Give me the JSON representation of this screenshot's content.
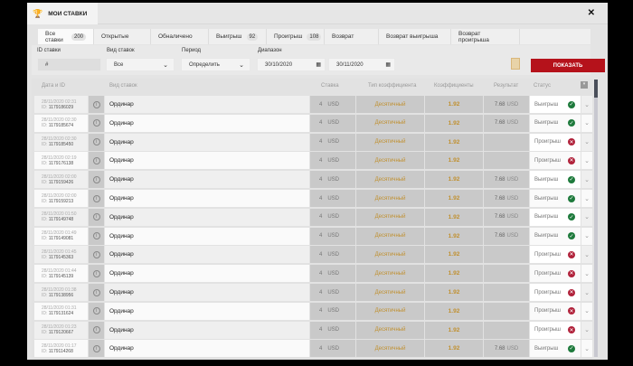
{
  "window": {
    "title": "МОИ СТАВКИ"
  },
  "tabs": [
    {
      "label": "Все ставки",
      "count": "200"
    },
    {
      "label": "Открытые"
    },
    {
      "label": "Обналичено"
    },
    {
      "label": "Выигрыш",
      "count": "92"
    },
    {
      "label": "Проигрыш",
      "count": "108"
    },
    {
      "label": "Возврат"
    },
    {
      "label": "Возврат выигрыша"
    },
    {
      "label": "Возврат проигрыша"
    }
  ],
  "filters": {
    "id_label": "ID ставки",
    "id_placeholder": "#",
    "type_label": "Вид ставок",
    "type_value": "Все",
    "period_label": "Период",
    "period_value": "Определить",
    "range_label": "Диапазон",
    "date_from": "30/10/2020",
    "date_to": "30/11/2020",
    "show_button": "ПОКАЗАТЬ"
  },
  "columns": [
    "Дата и ID",
    "Вид ставок",
    "Ставка",
    "Тип коэффициента",
    "Коэффициенты",
    "Результат",
    "Статус"
  ],
  "colors": {
    "win": "#1e7a3c",
    "loss": "#b0213a",
    "accent": "#b5121b",
    "odds": "#c09030"
  },
  "rows": [
    {
      "date": "28/11/2020 02:31",
      "id": "1179186029",
      "type": "Ординар",
      "stake": "4",
      "currency": "USD",
      "odds_type": "Десятичный",
      "odds": "1.92",
      "result": "7.68",
      "result_cur": "USD",
      "status": "Выигрыш",
      "win": true
    },
    {
      "date": "28/11/2020 02:30",
      "id": "1179185674",
      "type": "Ординар",
      "stake": "4",
      "currency": "USD",
      "odds_type": "Десятичный",
      "odds": "1.92",
      "result": "7.68",
      "result_cur": "USD",
      "status": "Выигрыш",
      "win": true
    },
    {
      "date": "28/11/2020 02:30",
      "id": "1179185450",
      "type": "Ординар",
      "stake": "4",
      "currency": "USD",
      "odds_type": "Десятичный",
      "odds": "1.92",
      "result": "",
      "result_cur": "",
      "status": "Проигрыш",
      "win": false
    },
    {
      "date": "28/11/2020 02:19",
      "id": "1179176138",
      "type": "Ординар",
      "stake": "4",
      "currency": "USD",
      "odds_type": "Десятичный",
      "odds": "1.92",
      "result": "",
      "result_cur": "",
      "status": "Проигрыш",
      "win": false
    },
    {
      "date": "28/11/2020 02:00",
      "id": "1179159426",
      "type": "Ординар",
      "stake": "4",
      "currency": "USD",
      "odds_type": "Десятичный",
      "odds": "1.92",
      "result": "7.68",
      "result_cur": "USD",
      "status": "Выигрыш",
      "win": true
    },
    {
      "date": "28/11/2020 02:00",
      "id": "1179159213",
      "type": "Ординар",
      "stake": "4",
      "currency": "USD",
      "odds_type": "Десятичный",
      "odds": "1.92",
      "result": "7.68",
      "result_cur": "USD",
      "status": "Выигрыш",
      "win": true
    },
    {
      "date": "28/11/2020 01:50",
      "id": "1179149748",
      "type": "Ординар",
      "stake": "4",
      "currency": "USD",
      "odds_type": "Десятичный",
      "odds": "1.92",
      "result": "7.68",
      "result_cur": "USD",
      "status": "Выигрыш",
      "win": true
    },
    {
      "date": "28/11/2020 01:49",
      "id": "1179149081",
      "type": "Ординар",
      "stake": "4",
      "currency": "USD",
      "odds_type": "Десятичный",
      "odds": "1.92",
      "result": "7.68",
      "result_cur": "USD",
      "status": "Выигрыш",
      "win": true
    },
    {
      "date": "28/11/2020 01:45",
      "id": "1179145363",
      "type": "Ординар",
      "stake": "4",
      "currency": "USD",
      "odds_type": "Десятичный",
      "odds": "1.92",
      "result": "",
      "result_cur": "",
      "status": "Проигрыш",
      "win": false
    },
    {
      "date": "28/11/2020 01:44",
      "id": "1179145139",
      "type": "Ординар",
      "stake": "4",
      "currency": "USD",
      "odds_type": "Десятичный",
      "odds": "1.92",
      "result": "",
      "result_cur": "",
      "status": "Проигрыш",
      "win": false
    },
    {
      "date": "28/11/2020 01:38",
      "id": "1179138956",
      "type": "Ординар",
      "stake": "4",
      "currency": "USD",
      "odds_type": "Десятичный",
      "odds": "1.92",
      "result": "",
      "result_cur": "",
      "status": "Проигрыш",
      "win": false
    },
    {
      "date": "28/11/2020 01:31",
      "id": "1179131624",
      "type": "Ординар",
      "stake": "4",
      "currency": "USD",
      "odds_type": "Десятичный",
      "odds": "1.92",
      "result": "",
      "result_cur": "",
      "status": "Проигрыш",
      "win": false
    },
    {
      "date": "28/11/2020 01:23",
      "id": "1179120667",
      "type": "Ординар",
      "stake": "4",
      "currency": "USD",
      "odds_type": "Десятичный",
      "odds": "1.92",
      "result": "",
      "result_cur": "",
      "status": "Проигрыш",
      "win": false
    },
    {
      "date": "28/11/2020 01:17",
      "id": "1179114268",
      "type": "Ординар",
      "stake": "4",
      "currency": "USD",
      "odds_type": "Десятичный",
      "odds": "1.92",
      "result": "7.68",
      "result_cur": "USD",
      "status": "Выигрыш",
      "win": true
    }
  ],
  "id_prefix": "ID:"
}
